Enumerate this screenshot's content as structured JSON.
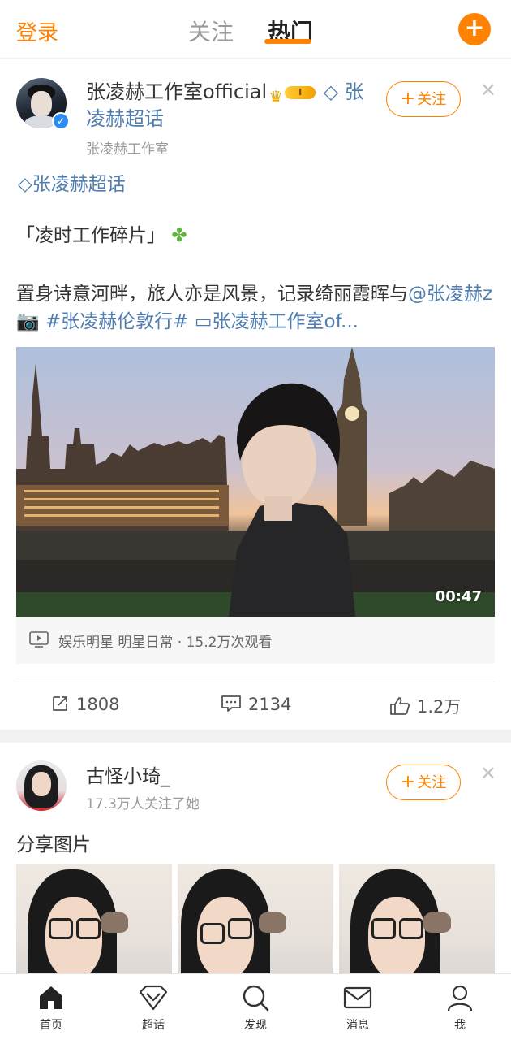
{
  "header": {
    "login_label": "登录",
    "tabs": [
      {
        "label": "关注",
        "active": false
      },
      {
        "label": "热门",
        "active": true
      }
    ],
    "compose_icon": "plus-circle-icon",
    "accent_color": "#ff8200"
  },
  "posts": [
    {
      "author": {
        "name": "张凌赫工作室official",
        "badge_level": "I",
        "supertopic_link": "张凌赫超话",
        "subtitle": "张凌赫工作室",
        "verified": true
      },
      "follow_label": "关注",
      "topic_tag": "张凌赫超话",
      "paragraph1": "「凌时工作碎片」",
      "paragraph2_text": "置身诗意河畔，旅人亦是风景，记录绮丽霞晖与",
      "mention": "@张凌赫z",
      "hashtag": "#张凌赫伦敦行#",
      "video_link": "张凌赫工作室of...",
      "video": {
        "duration": "00:47",
        "info": "娱乐明星 明星日常 · 15.2万次观看"
      },
      "stats": {
        "reposts": "1808",
        "comments": "2134",
        "likes": "1.2万"
      }
    },
    {
      "author": {
        "name": "古怪小琦_",
        "subtitle": "17.3万人关注了她"
      },
      "follow_label": "关注",
      "text": "分享图片",
      "image_count_visible": 3
    }
  ],
  "bottom_nav": [
    {
      "label": "首页",
      "icon": "home-icon",
      "active": true
    },
    {
      "label": "超话",
      "icon": "diamond-icon",
      "active": false
    },
    {
      "label": "发现",
      "icon": "search-icon",
      "active": false
    },
    {
      "label": "消息",
      "icon": "mail-icon",
      "active": false
    },
    {
      "label": "我",
      "icon": "user-icon",
      "active": false
    }
  ],
  "colors": {
    "link": "#507daf",
    "accent": "#ff8200",
    "verified": "#2d8cf0"
  }
}
